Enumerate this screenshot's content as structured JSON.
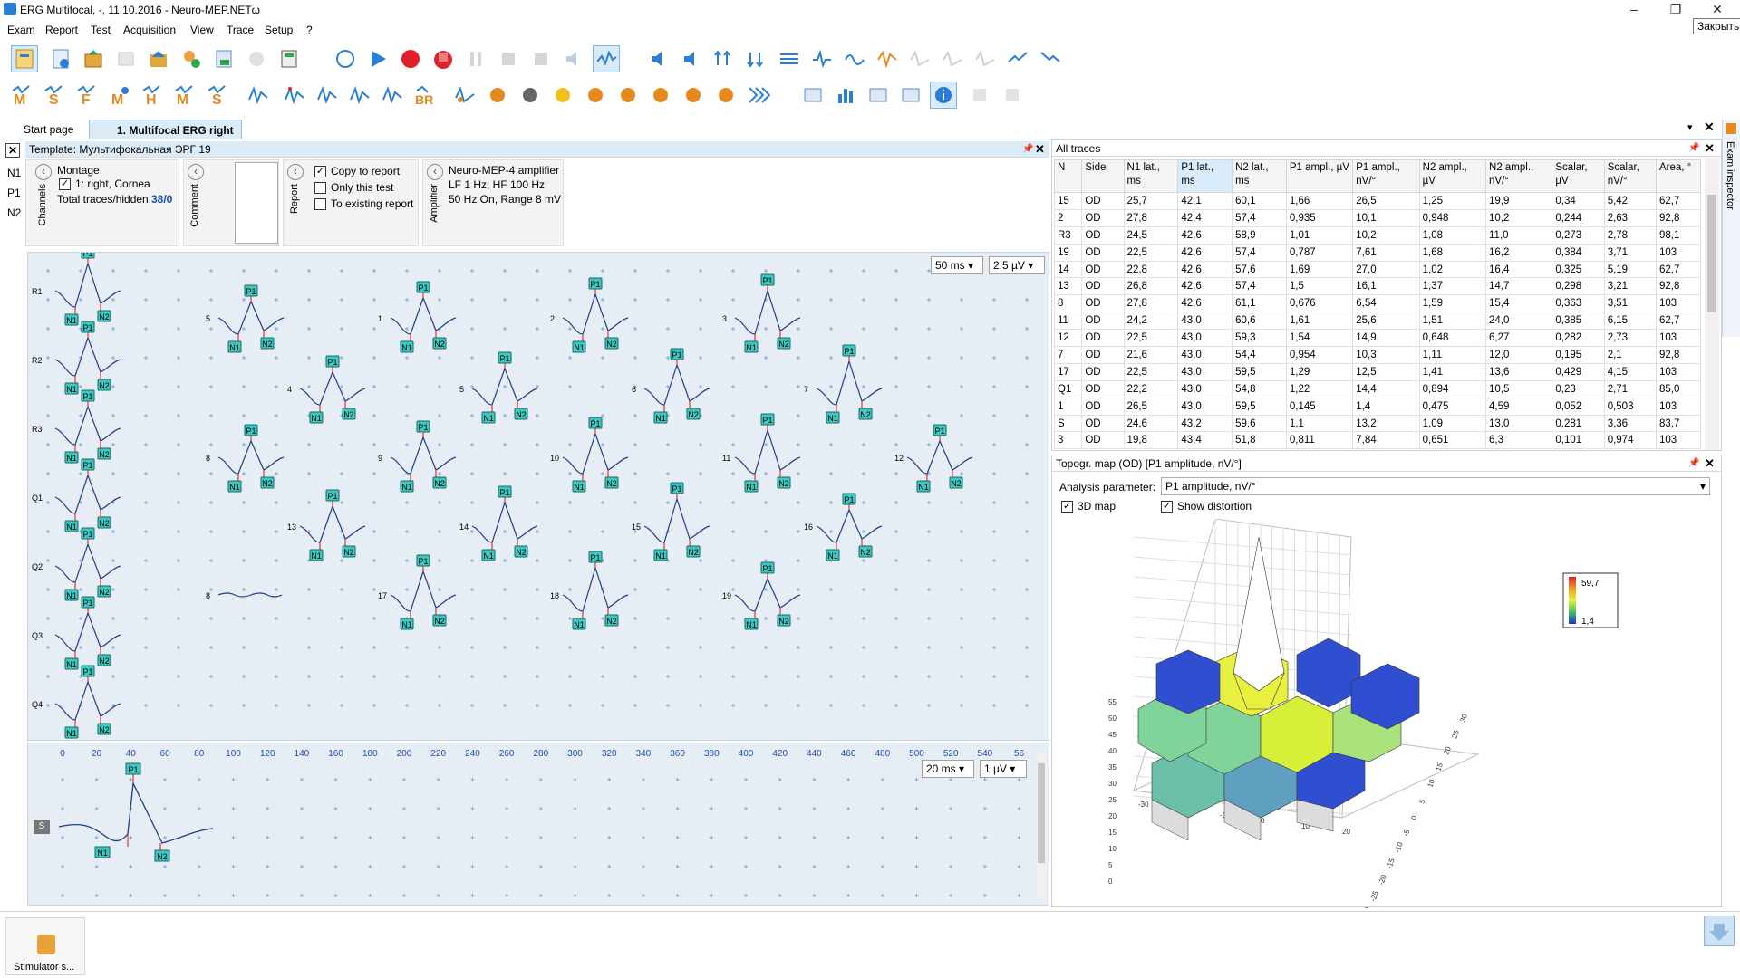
{
  "window": {
    "title": "ERG Multifocal, -, 11.10.2016 - Neuro-MEP.NETω",
    "close_tooltip": "Закрыть"
  },
  "menu": [
    "Exam",
    "Report",
    "Test",
    "Acquisition",
    "View",
    "Trace",
    "Setup",
    "?"
  ],
  "tabs": [
    {
      "label": "Start page"
    },
    {
      "label": "1. Multifocal ERG right"
    }
  ],
  "left_markers": [
    "N1",
    "P1",
    "N2"
  ],
  "template": {
    "title": "Template: Мультифокальная ЭРГ 19",
    "channels_label": "Channels",
    "montage_label": "Montage:",
    "montage_item": "1: right, Cornea",
    "total_traces_label": "Total traces/hidden:",
    "total_traces_value": "38/0",
    "comment_label": "Comment",
    "report_label": "Report",
    "copy_to_report": "Copy to report",
    "only_this_test": "Only this test",
    "to_existing_report": "To existing report",
    "amplifier_label": "Amplifier",
    "amp_name": "Neuro-MEP-4 amplifier",
    "amp_filters": "LF  1 Hz, HF  100 Hz",
    "amp_notch": "50 Hz  On, Range 8 mV"
  },
  "wave_controls": {
    "timebase": "50 ms",
    "sensitivity": "2.5 µV"
  },
  "bottom_controls": {
    "timebase": "20 ms",
    "sensitivity": "1 µV"
  },
  "ring_labels": [
    "R1",
    "R2",
    "R3",
    "Q1",
    "Q2",
    "Q3",
    "Q4"
  ],
  "hex_numbers": [
    "5",
    "1",
    "2",
    "3",
    "4",
    "5",
    "6",
    "7",
    "8",
    "9",
    "10",
    "11",
    "12",
    "13",
    "14",
    "15",
    "16",
    "8",
    "17",
    "18",
    "19"
  ],
  "axis_ticks": [
    "0",
    "20",
    "40",
    "60",
    "80",
    "100",
    "120",
    "140",
    "160",
    "180",
    "200",
    "220",
    "240",
    "260",
    "280",
    "300",
    "320",
    "340",
    "360",
    "380",
    "400",
    "420",
    "440",
    "460",
    "480",
    "500",
    "520",
    "540",
    "56"
  ],
  "bottom_trace_label": "S",
  "all_traces": {
    "title": "All traces",
    "columns": [
      "N",
      "Side",
      "N1 lat., ms",
      "P1 lat., ms",
      "N2 lat., ms",
      "P1 ampl., µV",
      "P1 ampl., nV/°",
      "N2 ampl., µV",
      "N2 ampl., nV/°",
      "Scalar, µV",
      "Scalar, nV/°",
      "Area, °"
    ],
    "rows": [
      [
        "15",
        "OD",
        "25,7",
        "42,1",
        "60,1",
        "1,66",
        "26,5",
        "1,25",
        "19,9",
        "0,34",
        "5,42",
        "62,7"
      ],
      [
        "2",
        "OD",
        "27,8",
        "42,4",
        "57,4",
        "0,935",
        "10,1",
        "0,948",
        "10,2",
        "0,244",
        "2,63",
        "92,8"
      ],
      [
        "R3",
        "OD",
        "24,5",
        "42,6",
        "58,9",
        "1,01",
        "10,2",
        "1,08",
        "11,0",
        "0,273",
        "2,78",
        "98,1"
      ],
      [
        "19",
        "OD",
        "22,5",
        "42,6",
        "57,4",
        "0,787",
        "7,61",
        "1,68",
        "16,2",
        "0,384",
        "3,71",
        "103"
      ],
      [
        "14",
        "OD",
        "22,8",
        "42,6",
        "57,6",
        "1,69",
        "27,0",
        "1,02",
        "16,4",
        "0,325",
        "5,19",
        "62,7"
      ],
      [
        "13",
        "OD",
        "26,8",
        "42,6",
        "57,4",
        "1,5",
        "16,1",
        "1,37",
        "14,7",
        "0,298",
        "3,21",
        "92,8"
      ],
      [
        "8",
        "OD",
        "27,8",
        "42,6",
        "61,1",
        "0,676",
        "6,54",
        "1,59",
        "15,4",
        "0,363",
        "3,51",
        "103"
      ],
      [
        "11",
        "OD",
        "24,2",
        "43,0",
        "60,6",
        "1,61",
        "25,6",
        "1,51",
        "24,0",
        "0,385",
        "6,15",
        "62,7"
      ],
      [
        "12",
        "OD",
        "22,5",
        "43,0",
        "59,3",
        "1,54",
        "14,9",
        "0,648",
        "6,27",
        "0,282",
        "2,73",
        "103"
      ],
      [
        "7",
        "OD",
        "21,6",
        "43,0",
        "54,4",
        "0,954",
        "10,3",
        "1,11",
        "12,0",
        "0,195",
        "2,1",
        "92,8"
      ],
      [
        "17",
        "OD",
        "22,5",
        "43,0",
        "59,5",
        "1,29",
        "12,5",
        "1,41",
        "13,6",
        "0,429",
        "4,15",
        "103"
      ],
      [
        "Q1",
        "OD",
        "22,2",
        "43,0",
        "54,8",
        "1,22",
        "14,4",
        "0,894",
        "10,5",
        "0,23",
        "2,71",
        "85,0"
      ],
      [
        "1",
        "OD",
        "26,5",
        "43,0",
        "59,5",
        "0,145",
        "1,4",
        "0,475",
        "4,59",
        "0,052",
        "0,503",
        "103"
      ],
      [
        "S",
        "OD",
        "24,6",
        "43,2",
        "59,6",
        "1,1",
        "13,2",
        "1,09",
        "13,0",
        "0,281",
        "3,36",
        "83,7"
      ],
      [
        "3",
        "OD",
        "19,8",
        "43,4",
        "51,8",
        "0,811",
        "7,84",
        "0,651",
        "6,3",
        "0,101",
        "0,974",
        "103"
      ]
    ]
  },
  "topo": {
    "title": "Topogr. map (OD) [P1 amplitude, nV/°]",
    "param_label": "Analysis parameter:",
    "param_value": "P1 amplitude, nV/°",
    "map3d_label": "3D map",
    "distortion_label": "Show distortion",
    "legend_max": "59,7",
    "legend_min": "1,4",
    "z_ticks": [
      "55",
      "50",
      "45",
      "40",
      "35",
      "30",
      "25",
      "20",
      "15",
      "10",
      "5",
      "0"
    ],
    "y_ticks": [
      "30",
      "25",
      "20",
      "15",
      "10",
      "5",
      "0",
      "-5",
      "-10",
      "-15",
      "-20",
      "-25",
      "-30"
    ],
    "x_ticks": [
      "-30",
      "-20",
      "-10",
      "0",
      "10",
      "20"
    ]
  },
  "inspector_label": "Exam inspector",
  "status": {
    "stimulator_label": "Stimulator s..."
  }
}
